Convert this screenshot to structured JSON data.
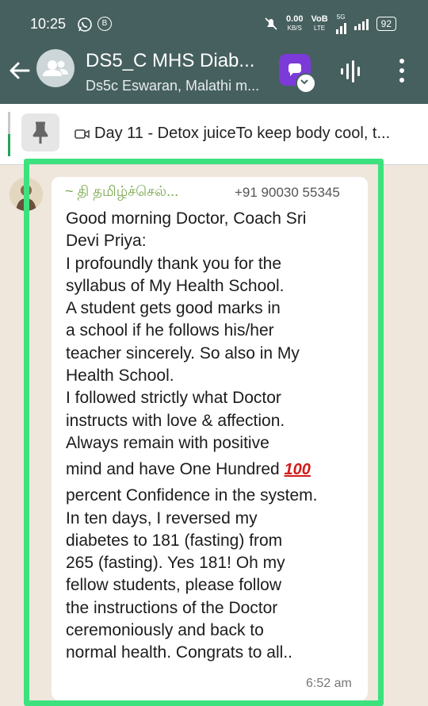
{
  "status_bar": {
    "time": "10:25",
    "icons": [
      "whatsapp-icon",
      "b-icon",
      "mute-icon",
      "volte-icon",
      "signal-icon"
    ],
    "net_speed": "0.00",
    "net_unit": "KB/S",
    "volte": "VoB",
    "lte": "LTE",
    "network": "5G",
    "battery": "92"
  },
  "header": {
    "title": "DS5_C MHS Diab...",
    "subtitle": "Ds5c Eswaran, Malathi m...",
    "colors": {
      "bar": "#46605f",
      "accent": "#7c3bd9"
    }
  },
  "pinned": {
    "text": "Day 11 - Detox juiceTo keep body cool, t..."
  },
  "message": {
    "sender": "~ தி தமிழ்ச்செல்...",
    "phone": "+91 90030 55345",
    "lines": [
      "Good morning Doctor, Coach Sri",
      "Devi Priya:",
      "I profoundly thank you for the",
      "syllabus of My Health School.",
      "A student gets good marks in",
      "a school if he follows his/her",
      "teacher sincerely. So also in My",
      "Health School.",
      "I followed strictly what Doctor",
      "instructs with love & affection.",
      "Always remain with positive",
      "mind and have One Hundred",
      "percent Confidence in the system.",
      "In ten days, I reversed my",
      "diabetes to 181 (fasting) from",
      "265 (fasting). Yes 181! Oh my",
      "fellow students, please follow",
      "the instructions of the Doctor",
      "ceremoniously and back to",
      "normal health. Congrats to all.."
    ],
    "emoji": "100",
    "time": "6:52 am"
  }
}
